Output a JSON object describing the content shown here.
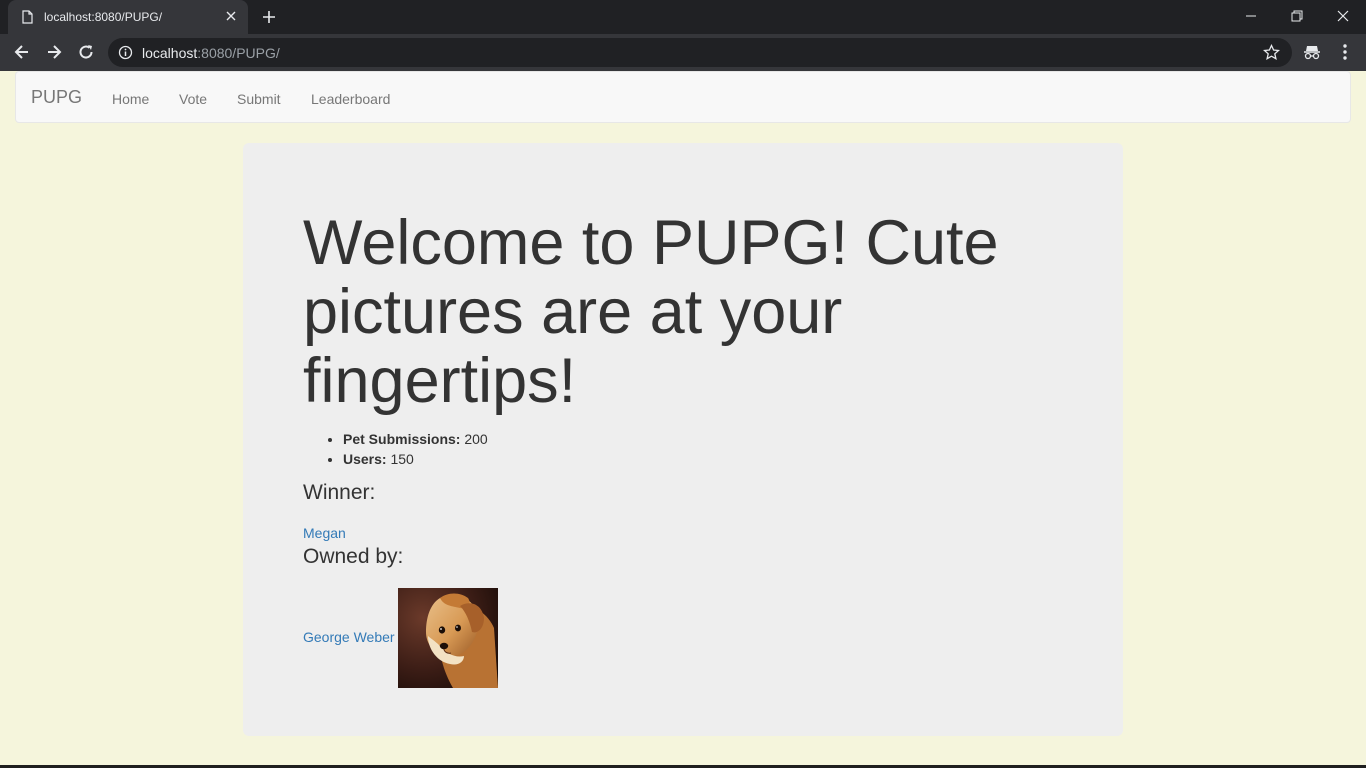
{
  "browser": {
    "tab_title": "localhost:8080/PUPG/",
    "url_host": "localhost",
    "url_path": ":8080/PUPG/"
  },
  "navbar": {
    "brand": "PUPG",
    "links": [
      "Home",
      "Vote",
      "Submit",
      "Leaderboard"
    ]
  },
  "main": {
    "headline": "Welcome to PUPG! Cute pictures are at your fingertips!",
    "stats": [
      {
        "label": "Pet Submissions:",
        "value": "200"
      },
      {
        "label": "Users:",
        "value": "150"
      }
    ],
    "winner_heading": "Winner:",
    "winner_name": "Megan",
    "owner_heading": "Owned by:",
    "owner_name": "George Weber"
  },
  "colors": {
    "page_bg": "#f5f5dc",
    "jumbotron_bg": "#eeeeee",
    "link": "#337ab7",
    "text": "#333333"
  },
  "icons": [
    "page-icon",
    "close-icon",
    "plus-icon",
    "minimize-icon",
    "restore-icon",
    "back-arrow-icon",
    "forward-arrow-icon",
    "reload-icon",
    "info-icon",
    "star-icon",
    "incognito-icon",
    "kebab-menu-icon"
  ]
}
